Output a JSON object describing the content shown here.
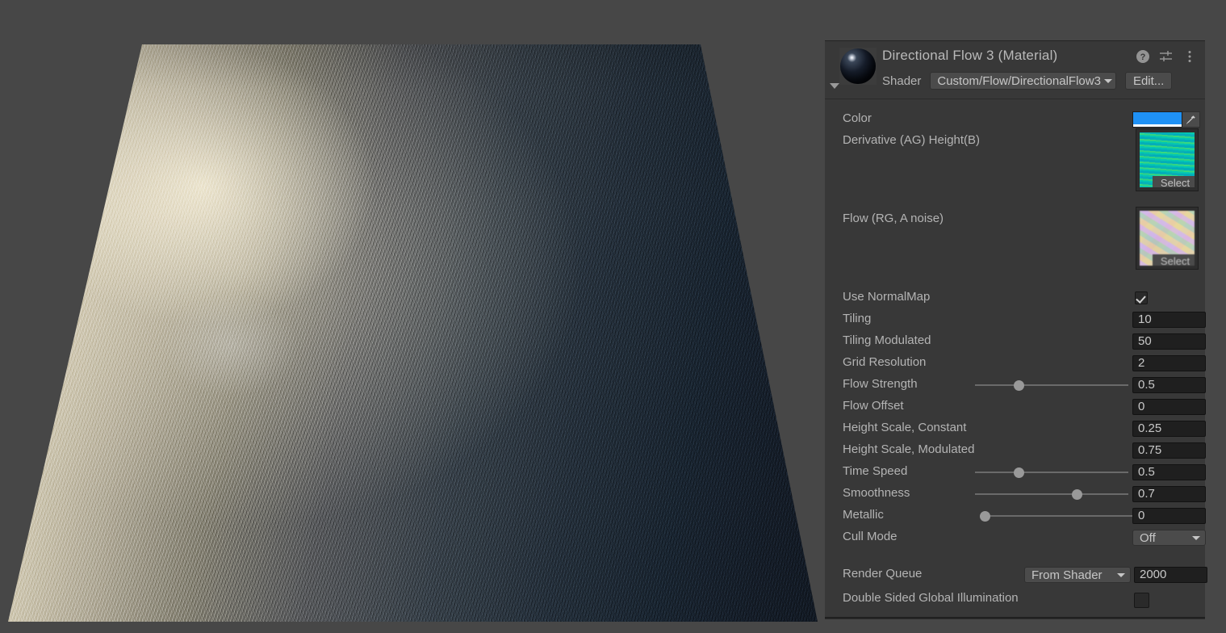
{
  "scene": {
    "name": "scene-viewport",
    "object": "water-plane-with-directional-flow-shader"
  },
  "inspector": {
    "title": "Directional Flow 3 (Material)",
    "foldout_icon": "triangle-down-icon",
    "preview_icon": "material-preview-sphere",
    "header_icons": [
      {
        "name": "help-icon",
        "glyph": "?"
      },
      {
        "name": "preset-icon",
        "glyph": "sliders"
      },
      {
        "name": "more-menu-icon",
        "glyph": "kebab"
      }
    ],
    "shader": {
      "label": "Shader",
      "value": "Custom/Flow/DirectionalFlow3",
      "edit_label": "Edit..."
    },
    "properties": {
      "color": {
        "label": "Color",
        "value_hex": "#1f91f5",
        "alpha_hex": "#ffffff",
        "eyedropper_icon": "eyedropper-icon"
      },
      "derivative_height": {
        "label": "Derivative (AG) Height(B)",
        "select_label": "Select",
        "thumbnail": "derivative-height-texture"
      },
      "flow": {
        "label": "Flow (RG, A noise)",
        "select_label": "Select",
        "thumbnail": "flow-noise-texture"
      },
      "use_normalmap": {
        "label": "Use NormalMap",
        "checked": true
      },
      "tiling": {
        "label": "Tiling",
        "value": "10"
      },
      "tiling_modulated": {
        "label": "Tiling Modulated",
        "value": "50"
      },
      "grid_resolution": {
        "label": "Grid Resolution",
        "value": "2"
      },
      "flow_strength": {
        "label": "Flow Strength",
        "value": "0.5",
        "slider_pct": 27
      },
      "flow_offset": {
        "label": "Flow Offset",
        "value": "0"
      },
      "height_scale_constant": {
        "label": "Height Scale, Constant",
        "value": "0.25"
      },
      "height_scale_modulated": {
        "label": "Height Scale, Modulated",
        "value": "0.75"
      },
      "time_speed": {
        "label": "Time Speed",
        "value": "0.5",
        "slider_pct": 27
      },
      "smoothness": {
        "label": "Smoothness",
        "value": "0.7",
        "slider_pct": 68
      },
      "metallic": {
        "label": "Metallic",
        "value": "0",
        "slider_pct": 0
      },
      "cull_mode": {
        "label": "Cull Mode",
        "value": "Off"
      },
      "render_queue": {
        "label": "Render Queue",
        "mode": "From Shader",
        "value": "2000"
      },
      "double_sided_gi": {
        "label": "Double Sided Global Illumination",
        "checked": false
      }
    }
  }
}
